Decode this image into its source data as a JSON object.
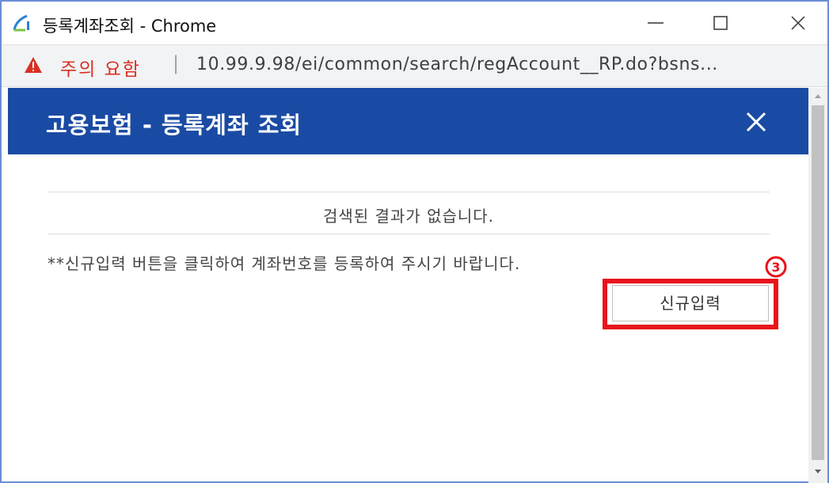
{
  "window": {
    "title": "등록계좌조회 - Chrome"
  },
  "addressbar": {
    "warning": "주의 요함",
    "separator": "|",
    "url": "10.99.9.98/ei/common/search/regAccount__RP.do?bsns..."
  },
  "popup": {
    "title": "고용보험 - 등록계좌 조회",
    "close_icon": "close-icon",
    "result_message": "검색된 결과가 없습니다.",
    "notice": "**신규입력 버튼을 클릭하여 계좌번호를 등록하여 주시기 바랍니다.",
    "step_marker": "③",
    "new_entry_button": "신규입력"
  },
  "colors": {
    "header_bg": "#1a4ba4",
    "highlight": "#e8141b",
    "warning": "#d93025",
    "window_border": "#6b8dd6"
  }
}
